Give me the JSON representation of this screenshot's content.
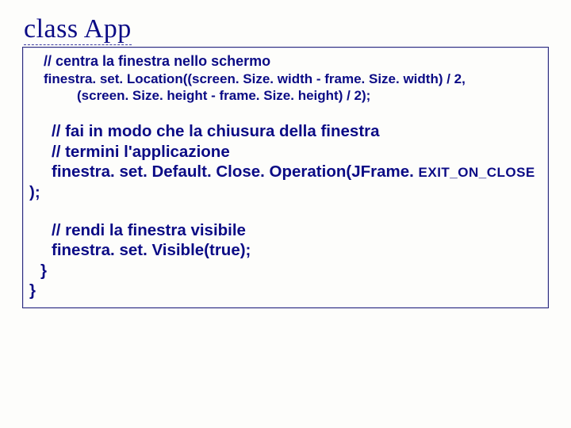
{
  "title": "class App",
  "code": {
    "c1": "// centra la finestra nello schermo",
    "c2": "finestra. set. Location((screen. Size. width - frame. Size. width) / 2,",
    "c2b": "(screen. Size. height - frame. Size. height) / 2);",
    "c3a": "// fai in modo che la chiusura della finestra",
    "c3b": "// termini l'applicazione",
    "c3c_big": "finestra. set. Default. Close. Operation(JFrame. ",
    "c3c_sm": "EXIT_ON_CLOSE",
    "c3d": ");",
    "c4a": "// rendi la finestra visibile",
    "c4b": "finestra. set. Visible(true);",
    "brace1": "}",
    "brace0": "}"
  }
}
